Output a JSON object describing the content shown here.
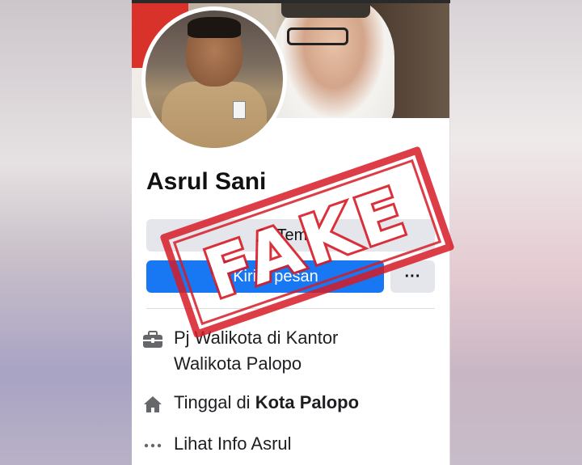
{
  "profile": {
    "name": "Asrul Sani"
  },
  "actions": {
    "friend_label": "Teman",
    "message_label": "Kirim pesan",
    "more_label": "···"
  },
  "info": [
    {
      "icon": "briefcase-icon",
      "line1": "Pj Walikota di Kantor",
      "line2": "Walikota Palopo"
    },
    {
      "icon": "home-icon",
      "prefix": "Tinggal di ",
      "bold": "Kota Palopo"
    },
    {
      "icon": "more-dots-icon",
      "text": "Lihat Info Asrul"
    }
  ],
  "stamp": {
    "text": "FAKE"
  },
  "colors": {
    "accent": "#1877f2",
    "stamp": "#d71b26",
    "button_gray": "#e4e6eb"
  }
}
